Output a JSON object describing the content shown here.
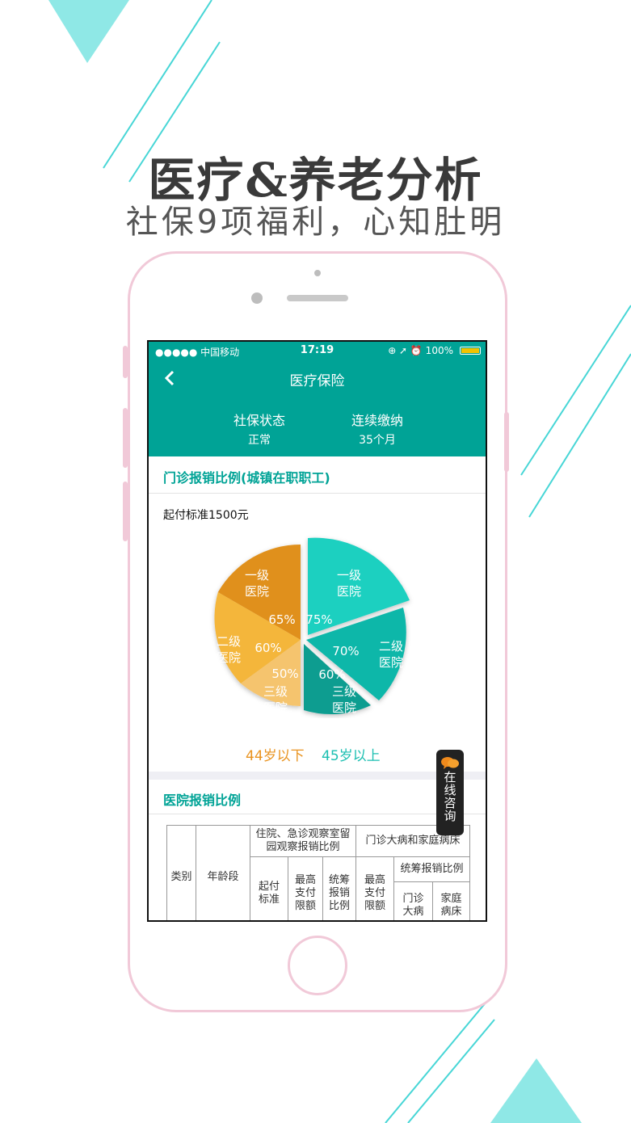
{
  "promo": {
    "headline": "医疗&养老分析",
    "subline": "社保9项福利，心知肚明"
  },
  "colors": {
    "teal": "#00a396",
    "accent_cyan": "#47d6d6",
    "phone_border": "#f1c9d8",
    "orange_dark": "#e0901a",
    "orange_light": "#f4b63a",
    "teal_light": "#27cdbf"
  },
  "statusbar": {
    "carrier": "●●●●● 中国移动",
    "time": "17:19",
    "right": "⊕ ➚ ⏰ 100%"
  },
  "nav": {
    "back_icon": "chevron-left-icon",
    "title": "医疗保险"
  },
  "summary": {
    "status_label": "社保状态",
    "status_value": "正常",
    "paid_label": "连续缴纳",
    "paid_value": "35个月"
  },
  "outpatient": {
    "title": "门诊报销比例(城镇在职职工)",
    "threshold": "起付标准1500元",
    "slices": [
      {
        "group": "44岁以下",
        "hospital": "一级医院",
        "line1": "一级",
        "line2": "医院",
        "percent": "65%"
      },
      {
        "group": "44岁以下",
        "hospital": "二级医院",
        "line1": "二级",
        "line2": "医院",
        "percent": "60%"
      },
      {
        "group": "44岁以下",
        "hospital": "三级医院",
        "line1": "三级",
        "line2": "医院",
        "percent": "50%"
      },
      {
        "group": "45岁以上",
        "hospital": "一级医院",
        "line1": "一级",
        "line2": "医院",
        "percent": "75%"
      },
      {
        "group": "45岁以上",
        "hospital": "二级医院",
        "line1": "二级",
        "line2": "医院",
        "percent": "70%"
      },
      {
        "group": "45岁以上",
        "hospital": "三级医院",
        "line1": "三级",
        "line2": "医院",
        "percent": "60%"
      }
    ],
    "legend_under44": "44岁以下",
    "legend_over45": "45岁以上"
  },
  "hospital": {
    "title": "医院报销比例",
    "table": {
      "col_category": "类别",
      "col_age": "年龄段",
      "group_inpatient": "住院、急诊观察室留园观察报销比例",
      "group_outpatient": "门诊大病和家庭病床",
      "sub_threshold": "起付标准",
      "sub_max_pay": "最高支付限额",
      "sub_pool_ratio": "统筹报销比例",
      "sub_max_pay2": "最高支付限额",
      "sub_pool_ratio2": "统筹报销比例",
      "sub_outpatient_major": "门诊大病",
      "sub_home_bed": "家庭病床"
    }
  },
  "consult": {
    "icon": "chat-bubbles-icon",
    "label": "在线咨询"
  }
}
